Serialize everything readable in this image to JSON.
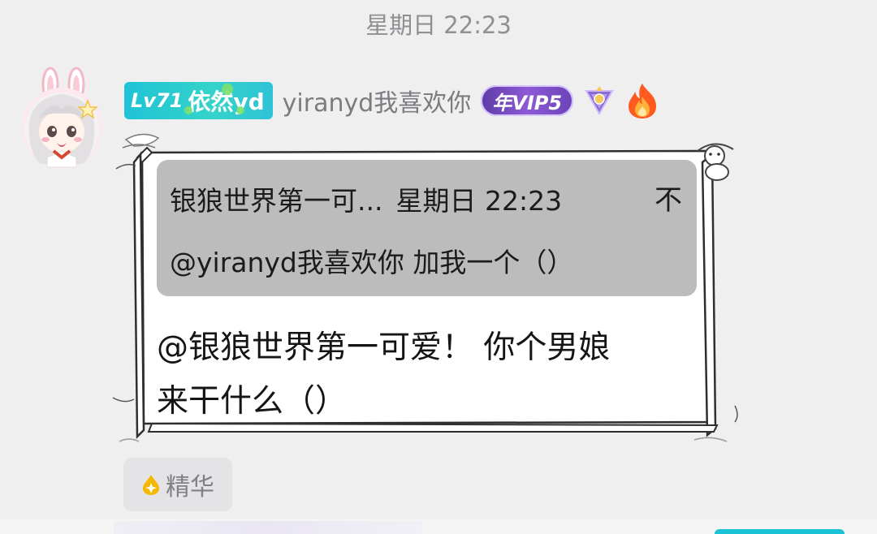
{
  "timestamp": "星期日 22:23",
  "sender": {
    "level_prefix": "Lv71",
    "level_name": "依然yd",
    "nickname": "yiranyd我喜欢你",
    "vip_label": "年VIP5",
    "avatar_icon": "anime-girl-avatar-icon",
    "triangle_badge_icon": "purple-triangle-badge-icon",
    "fire_badge_icon": "flame-badge-icon"
  },
  "quote": {
    "sender": "银狼世界第一可...",
    "time": "星期日 22:23",
    "close_symbol": "不",
    "text": "@yiranyd我喜欢你 加我一个（）"
  },
  "message": {
    "line1": "@银狼世界第一可爱！ 你个男娘",
    "line2": "来干什么（）"
  },
  "essence_tag": {
    "label": "精华",
    "icon": "gold-droplet-icon"
  },
  "colors": {
    "background": "#efeff0",
    "level_badge": "#1fc3d6",
    "vip_badge": "#6b43b7",
    "quote_background": "#bcbcbc"
  }
}
